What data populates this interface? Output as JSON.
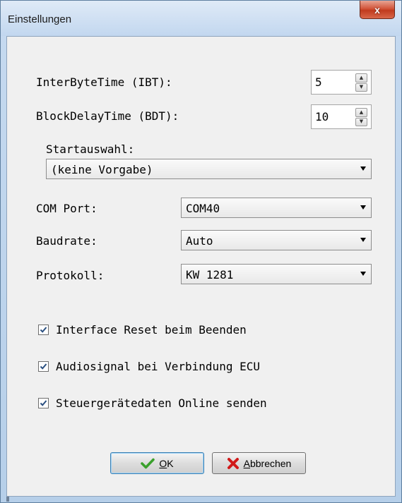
{
  "window": {
    "title": "Einstellungen",
    "close_glyph": "x"
  },
  "fields": {
    "ibt_label": "InterByteTime (IBT):",
    "ibt_value": "5",
    "bdt_label": "BlockDelayTime (BDT):",
    "bdt_value": "10",
    "start_label": "Startauswahl:",
    "start_value": "(keine Vorgabe)",
    "com_label": "COM Port:",
    "com_value": "COM40",
    "baud_label": "Baudrate:",
    "baud_value": "Auto",
    "proto_label": "Protokoll:",
    "proto_value": "KW 1281"
  },
  "options": [
    {
      "label": "Interface Reset beim Beenden",
      "checked": true
    },
    {
      "label": "Audiosignal bei Verbindung ECU",
      "checked": true
    },
    {
      "label": "Steuergerätedaten Online senden",
      "checked": true
    }
  ],
  "buttons": {
    "ok_label": "OK",
    "cancel_label": "Abbrechen"
  },
  "colors": {
    "accent": "#3c7fb1",
    "close": "#c13b1e",
    "ok_check": "#3aa02c",
    "cancel_x": "#d11a1a"
  },
  "icons": {
    "ok": "checkmark-icon",
    "cancel": "red-x-icon"
  }
}
